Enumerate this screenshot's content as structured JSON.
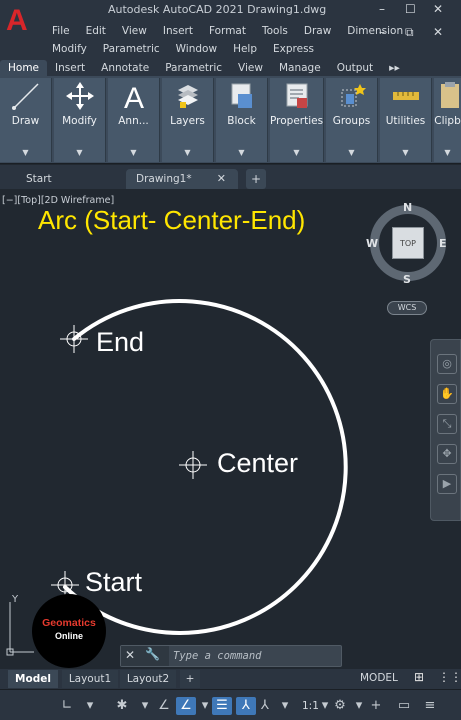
{
  "window": {
    "title": "Autodesk AutoCAD 2021   Drawing1.dwg",
    "app_letter": "A",
    "controls": {
      "minimize": "–",
      "restore": "☐",
      "close": "✕",
      "doc_minimize": "–",
      "doc_restore": "⧉",
      "doc_close": "✕"
    }
  },
  "menu": {
    "row1": [
      "File",
      "Edit",
      "View",
      "Insert",
      "Format",
      "Tools",
      "Draw",
      "Dimension"
    ],
    "row2": [
      "Modify",
      "Parametric",
      "Window",
      "Help",
      "Express"
    ]
  },
  "ribbon_tabs": [
    "Home",
    "Insert",
    "Annotate",
    "Parametric",
    "View",
    "Manage",
    "Output",
    "▸▸"
  ],
  "ribbon_panels": [
    {
      "label": "Draw",
      "icon": "line-icon"
    },
    {
      "label": "Modify",
      "icon": "move-icon"
    },
    {
      "label": "Ann...",
      "icon": "text-icon"
    },
    {
      "label": "Layers",
      "icon": "layers-icon"
    },
    {
      "label": "Block",
      "icon": "block-icon"
    },
    {
      "label": "Properties",
      "icon": "properties-icon"
    },
    {
      "label": "Groups",
      "icon": "groups-icon"
    },
    {
      "label": "Utilities",
      "icon": "measure-icon"
    },
    {
      "label": "Clipb",
      "icon": "clipboard-icon"
    }
  ],
  "file_tabs": {
    "start": "Start",
    "drawing": "Drawing1*",
    "close": "✕",
    "add": "+"
  },
  "canvas": {
    "view_label": "[−][Top][2D Wireframe]",
    "title": "Arc (Start- Center-End)",
    "labels": {
      "end": "End",
      "center": "Center",
      "start": "Start"
    },
    "arc_color": "#ffffff",
    "title_color": "#ffe600"
  },
  "viewcube": {
    "top_face": "TOP",
    "north": "N",
    "south": "S",
    "east": "E",
    "west": "W",
    "wcs": "WCS"
  },
  "ucs": {
    "y": "Y"
  },
  "watermark": {
    "line1": "Geomatics",
    "line2": "Online"
  },
  "command_line": {
    "placeholder": "Type a command",
    "close": "✕",
    "tools": "🔧"
  },
  "layout_tabs": [
    "Model",
    "Layout1",
    "Layout2",
    "+"
  ],
  "status": {
    "model": "MODEL",
    "scale": "1:1"
  }
}
